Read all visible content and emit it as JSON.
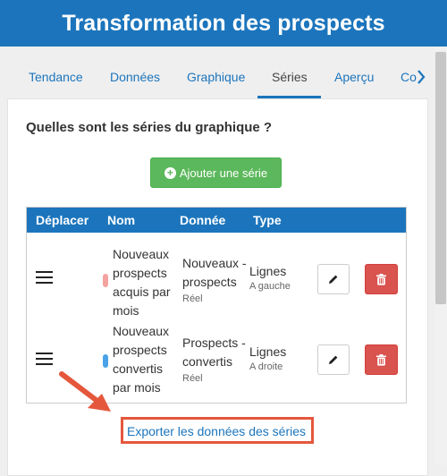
{
  "header": {
    "title": "Transformation des prospects"
  },
  "tabs": [
    {
      "label": "Tendance",
      "active": false
    },
    {
      "label": "Données",
      "active": false
    },
    {
      "label": "Graphique",
      "active": false
    },
    {
      "label": "Séries",
      "active": true
    },
    {
      "label": "Aperçu",
      "active": false
    },
    {
      "label": "Co",
      "active": false
    }
  ],
  "panel": {
    "question": "Quelles sont les séries du graphique ?",
    "add_button": "Ajouter une série",
    "columns": [
      "Déplacer",
      "Nom",
      "Donnée",
      "Type"
    ],
    "rows": [
      {
        "name_lines": [
          "Nouveaux",
          "prospects",
          "acquis par",
          "mois"
        ],
        "color": "#f4a3a0",
        "donnee_lines": [
          "Nouveaux -",
          "prospects"
        ],
        "donnee_sub": "Réel",
        "type": "Lignes",
        "type_sub": "A gauche"
      },
      {
        "name_lines": [
          "Nouveaux",
          "prospects",
          "convertis",
          "par mois"
        ],
        "color": "#4aa3e8",
        "donnee_lines": [
          "Prospects -",
          "convertis"
        ],
        "donnee_sub": "Réel",
        "type": "Lignes",
        "type_sub": "A droite"
      }
    ],
    "export_link": "Exporter les données des séries"
  },
  "colors": {
    "brand": "#1c75bc",
    "success": "#5cb85c",
    "danger": "#d9534f",
    "highlight": "#e5573c"
  },
  "icons": [
    "plus-circle-icon",
    "hamburger-icon",
    "pencil-icon",
    "trash-icon",
    "chevron-right-icon",
    "arrow-icon"
  ]
}
